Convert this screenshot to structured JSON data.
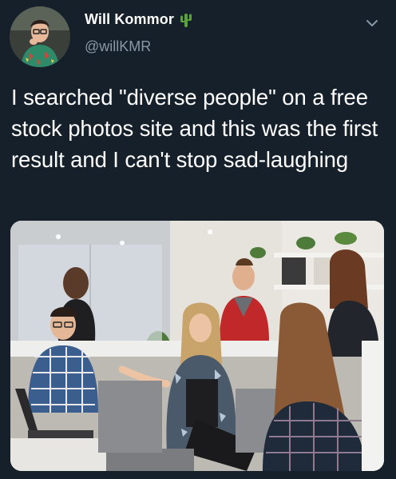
{
  "tweet": {
    "display_name": "Will Kommor",
    "handle": "@willKMR",
    "text": "I searched \"diverse people\" on a free stock photos site and this was the first result and I can't stop sad-laughing",
    "name_emoji": "cactus-icon",
    "menu_icon": "chevron-down-icon"
  },
  "colors": {
    "background": "#15202b",
    "text_primary": "#ffffff",
    "text_secondary": "#8899a6",
    "cactus": "#5aa33a"
  }
}
